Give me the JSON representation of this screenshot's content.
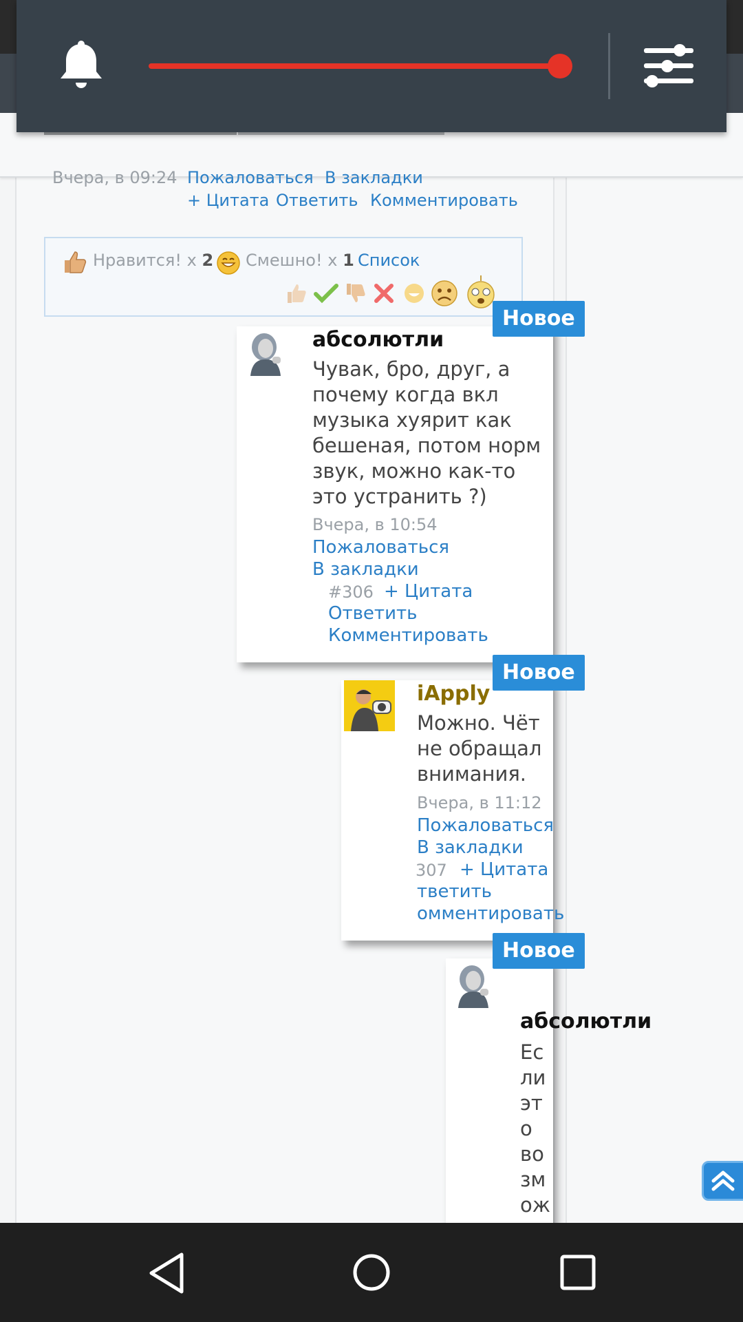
{
  "post": {
    "time": "Вчера, в 09:24",
    "report": "Пожаловаться",
    "bookmark": "В закладки",
    "quote": "+ Цитата",
    "reply": "Ответить",
    "comment": "Комментировать"
  },
  "reactions": {
    "like_label": "Нравится! x",
    "like_count": "2",
    "funny_label": "Смешно! x",
    "funny_count": "1",
    "list_link": "Список"
  },
  "comments": [
    {
      "badge": "Новое",
      "user": "абсолютли",
      "text": "Чувак, бро, друг, а почему когда вкл музыка хуярит как бешеная, потом норм звук, можно как-то это устранить ?)",
      "time": "Вчера, в 10:54",
      "report": "Пожаловаться",
      "bookmark": "В закладки",
      "num": "#306",
      "quote": "+ Цитата",
      "reply": "Ответить",
      "comment": "Комментировать"
    },
    {
      "badge": "Новое",
      "user": "iApply",
      "text": "Можно. Чёт не обращал внимания.",
      "time": "Вчера, в 11:12",
      "report": "Пожаловаться",
      "bookmark": "В закладки",
      "num": "307",
      "quote": "+ Цитата",
      "reply": "тветить",
      "comment": "омментировать"
    },
    {
      "badge": "Новое",
      "user": "абсолютли",
      "text_lines": [
        "Ес",
        "ли",
        "эт",
        "о",
        "во",
        "зм",
        "ож"
      ]
    }
  ],
  "notification": {
    "volume_percent": 100
  },
  "colors": {
    "accent": "#2a8dd8",
    "link": "#2b7fc6",
    "slider": "#e53327",
    "panel": "#37414a"
  }
}
